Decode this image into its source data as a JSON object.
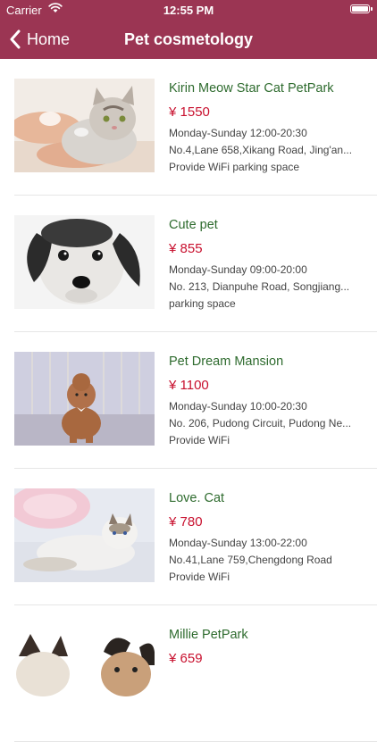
{
  "status_bar": {
    "carrier": "Carrier",
    "time": "12:55 PM"
  },
  "nav": {
    "back_label": "Home",
    "title": "Pet cosmetology"
  },
  "listings": [
    {
      "name": "Kirin Meow Star Cat PetPark",
      "price": "¥ 1550",
      "hours": "Monday-Sunday 12:00-20:30",
      "address": "No.4,Lane 658,Xikang Road, Jing'an...",
      "amenities": "Provide WiFi parking space",
      "image": "cat-bath-photo"
    },
    {
      "name": "Cute pet",
      "price": "¥ 855",
      "hours": "Monday-Sunday 09:00-20:00",
      "address": " No. 213, Dianpuhe Road, Songjiang...",
      "amenities": "parking space",
      "image": "schnauzer-photo"
    },
    {
      "name": "Pet Dream Mansion",
      "price": "¥ 1100",
      "hours": "Monday-Sunday 10:00-20:30",
      "address": " No. 206, Pudong Circuit, Pudong Ne...",
      "amenities": "Provide WiFi",
      "image": "poodle-photo"
    },
    {
      "name": "Love. Cat",
      "price": "¥ 780",
      "hours": "Monday-Sunday 13:00-22:00",
      "address": "No.41,Lane 759,Chengdong Road",
      "amenities": "Provide WiFi",
      "image": "ragdoll-cat-photo"
    },
    {
      "name": "Millie PetPark",
      "price": "¥ 659",
      "hours": "",
      "address": "",
      "amenities": "",
      "image": "cat-and-dog-photo"
    }
  ],
  "colors": {
    "header": "#9b3553",
    "name": "#2e6b2e",
    "price": "#c8102e"
  }
}
